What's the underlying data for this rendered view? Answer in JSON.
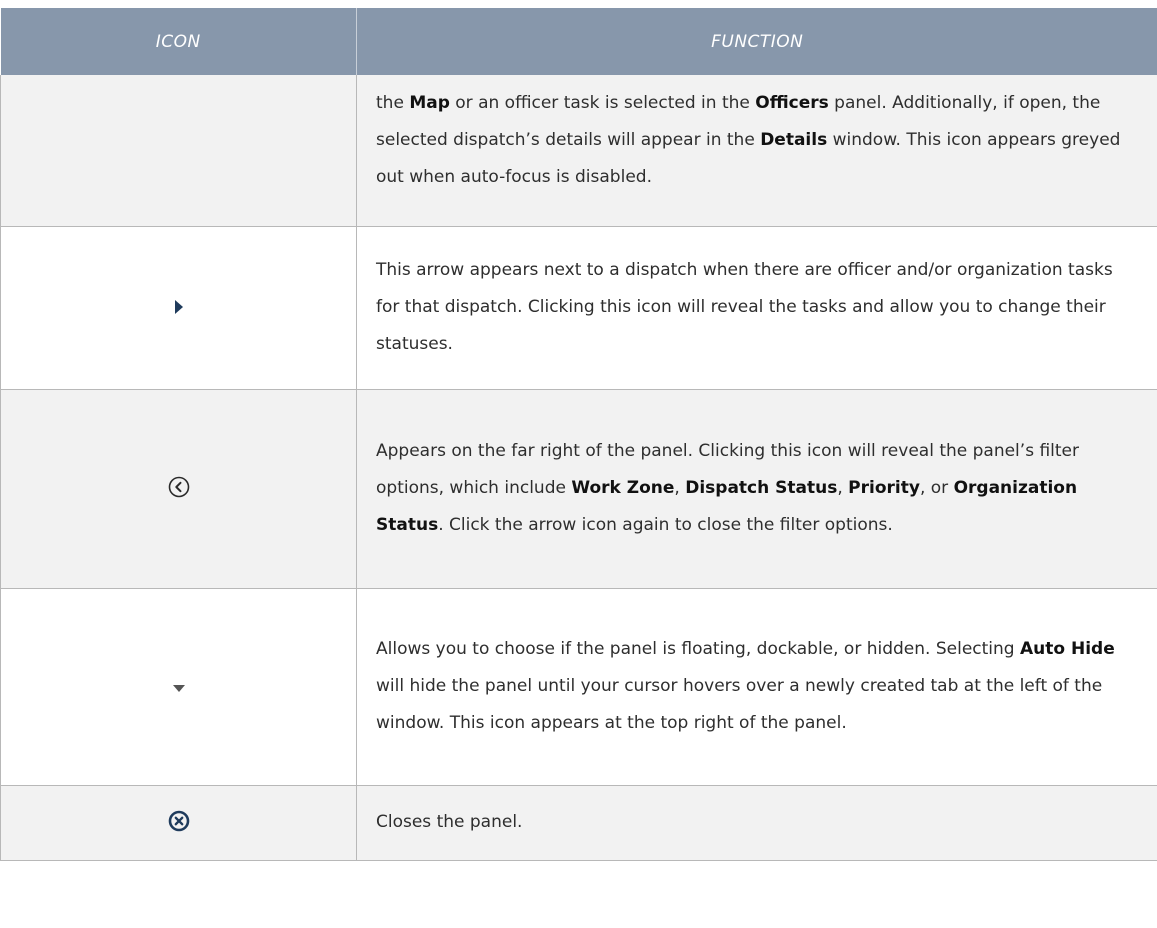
{
  "header": {
    "icon_col": "ICON",
    "function_col": "FUNCTION"
  },
  "rows": [
    {
      "icon": "none",
      "text": [
        {
          "t": "the "
        },
        {
          "t": "Map",
          "b": true
        },
        {
          "t": " or an officer task is selected in the "
        },
        {
          "t": "Officers",
          "b": true
        },
        {
          "t": " panel. Additionally, if open, the selected dispatch’s details will appear in the "
        },
        {
          "t": "Details",
          "b": true
        },
        {
          "t": " window. This icon appears greyed out when auto-focus is disabled."
        }
      ]
    },
    {
      "icon": "expand-arrow-icon",
      "text": [
        {
          "t": "This arrow appears next to a dispatch when there are officer and/or organization tasks for that dispatch. Clicking this icon will reveal the tasks and allow you to change their statuses."
        }
      ]
    },
    {
      "icon": "circle-chevron-left-icon",
      "text": [
        {
          "t": "Appears on the far right of the panel. Clicking this icon will reveal the panel’s filter options, which include "
        },
        {
          "t": "Work Zone",
          "b": true
        },
        {
          "t": ", "
        },
        {
          "t": "Dispatch Status",
          "b": true
        },
        {
          "t": ", "
        },
        {
          "t": "Priority",
          "b": true
        },
        {
          "t": ", or "
        },
        {
          "t": "Organization Status",
          "b": true
        },
        {
          "t": ". Click the arrow icon again to close the filter options."
        }
      ]
    },
    {
      "icon": "dropdown-triangle-icon",
      "text": [
        {
          "t": "Allows you to choose if the panel is floating, dockable, or hidden. Selecting "
        },
        {
          "t": "Auto Hide",
          "b": true
        },
        {
          "t": " will hide the panel until your cursor hovers over a newly created tab at the left of the window. This icon appears at the top right of the panel."
        }
      ]
    },
    {
      "icon": "close-circle-icon",
      "text": [
        {
          "t": "Closes the panel."
        }
      ]
    }
  ],
  "colors": {
    "header_bg": "#8797ab",
    "icon_navy": "#1f3b5c",
    "alt_row_bg": "#f2f2f2"
  }
}
